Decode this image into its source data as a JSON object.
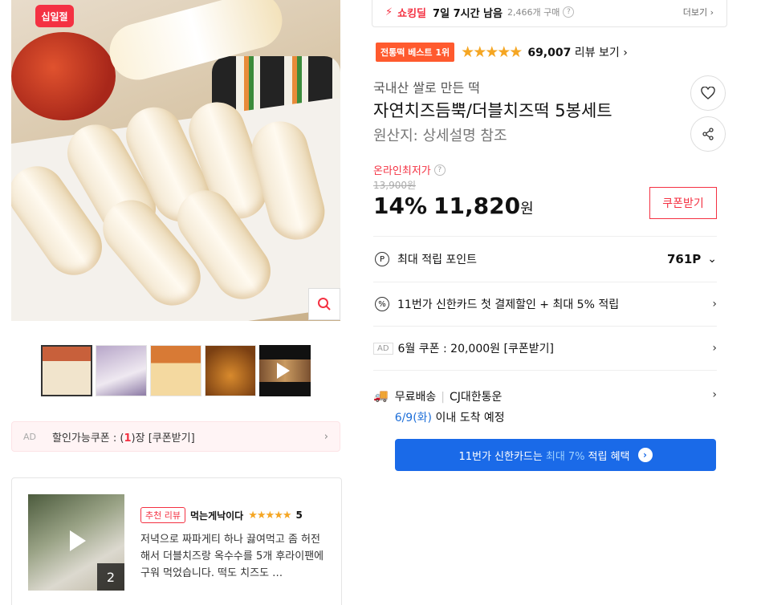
{
  "gallery": {
    "badge": "십일절",
    "zoom_icon": "search-icon",
    "thumbnails": [
      "thumb-1",
      "thumb-2",
      "thumb-3",
      "thumb-4",
      "thumb-video"
    ]
  },
  "coupon_bar": {
    "ad": "AD",
    "label_prefix": "할인가능쿠폰 : (",
    "count": "1",
    "label_suffix": ")장 [쿠폰받기]"
  },
  "review_card": {
    "media_count": "2",
    "badge": "추천 리뷰",
    "user": "먹는게낙이다",
    "stars": "★★★★★",
    "score": "5",
    "text": "저녁으로 짜파게티 하나 끓여먹고 좀 허전해서 더블치즈랑 옥수수를 5개 후라이팬에 구워 먹었습니다. 떡도 치즈도 …"
  },
  "deal": {
    "icon": "⚡",
    "label": "쇼킹딜",
    "time_left": "7일 7시간 남음",
    "sold": "2,466개 구매",
    "more": "더보기 ›"
  },
  "rating": {
    "best_badge": "전통떡 베스트 1위",
    "stars": "★★★★★",
    "review_count": "69,007",
    "review_label": " 리뷰 보기 ›"
  },
  "product": {
    "subtitle": "국내산 쌀로 만든 떡",
    "title": "자연치즈듬뿍/더블치즈떡 5봉세트",
    "origin": "원산지:  상세설명 참조"
  },
  "price": {
    "lowest_label": "온라인최저가",
    "original": "13,900원",
    "discount": "14%",
    "amount": "11,820",
    "unit": "원",
    "coupon_button": "쿠폰받기"
  },
  "info": {
    "points_label": "최대 적립 포인트",
    "points_value": "761P",
    "card_discount": "11번가 신한카드 첫 결제할인 + 최대 5% 적립",
    "ad": "AD",
    "coupon": "6월 쿠폰 : 20,000원 [쿠폰받기]",
    "shipping": "무료배송",
    "carrier": "CJ대한통운",
    "delivery_date": "6/9(화)",
    "delivery_suffix": " 이내 도착 예정"
  },
  "card_banner": {
    "prefix": "11번가 신한카드는 ",
    "highlight": "최대 7%",
    "suffix": " 적립 혜택",
    "arrow": "›"
  },
  "colors": {
    "accent": "#f43142",
    "blue": "#1a6ae8",
    "star": "#f5a623"
  }
}
